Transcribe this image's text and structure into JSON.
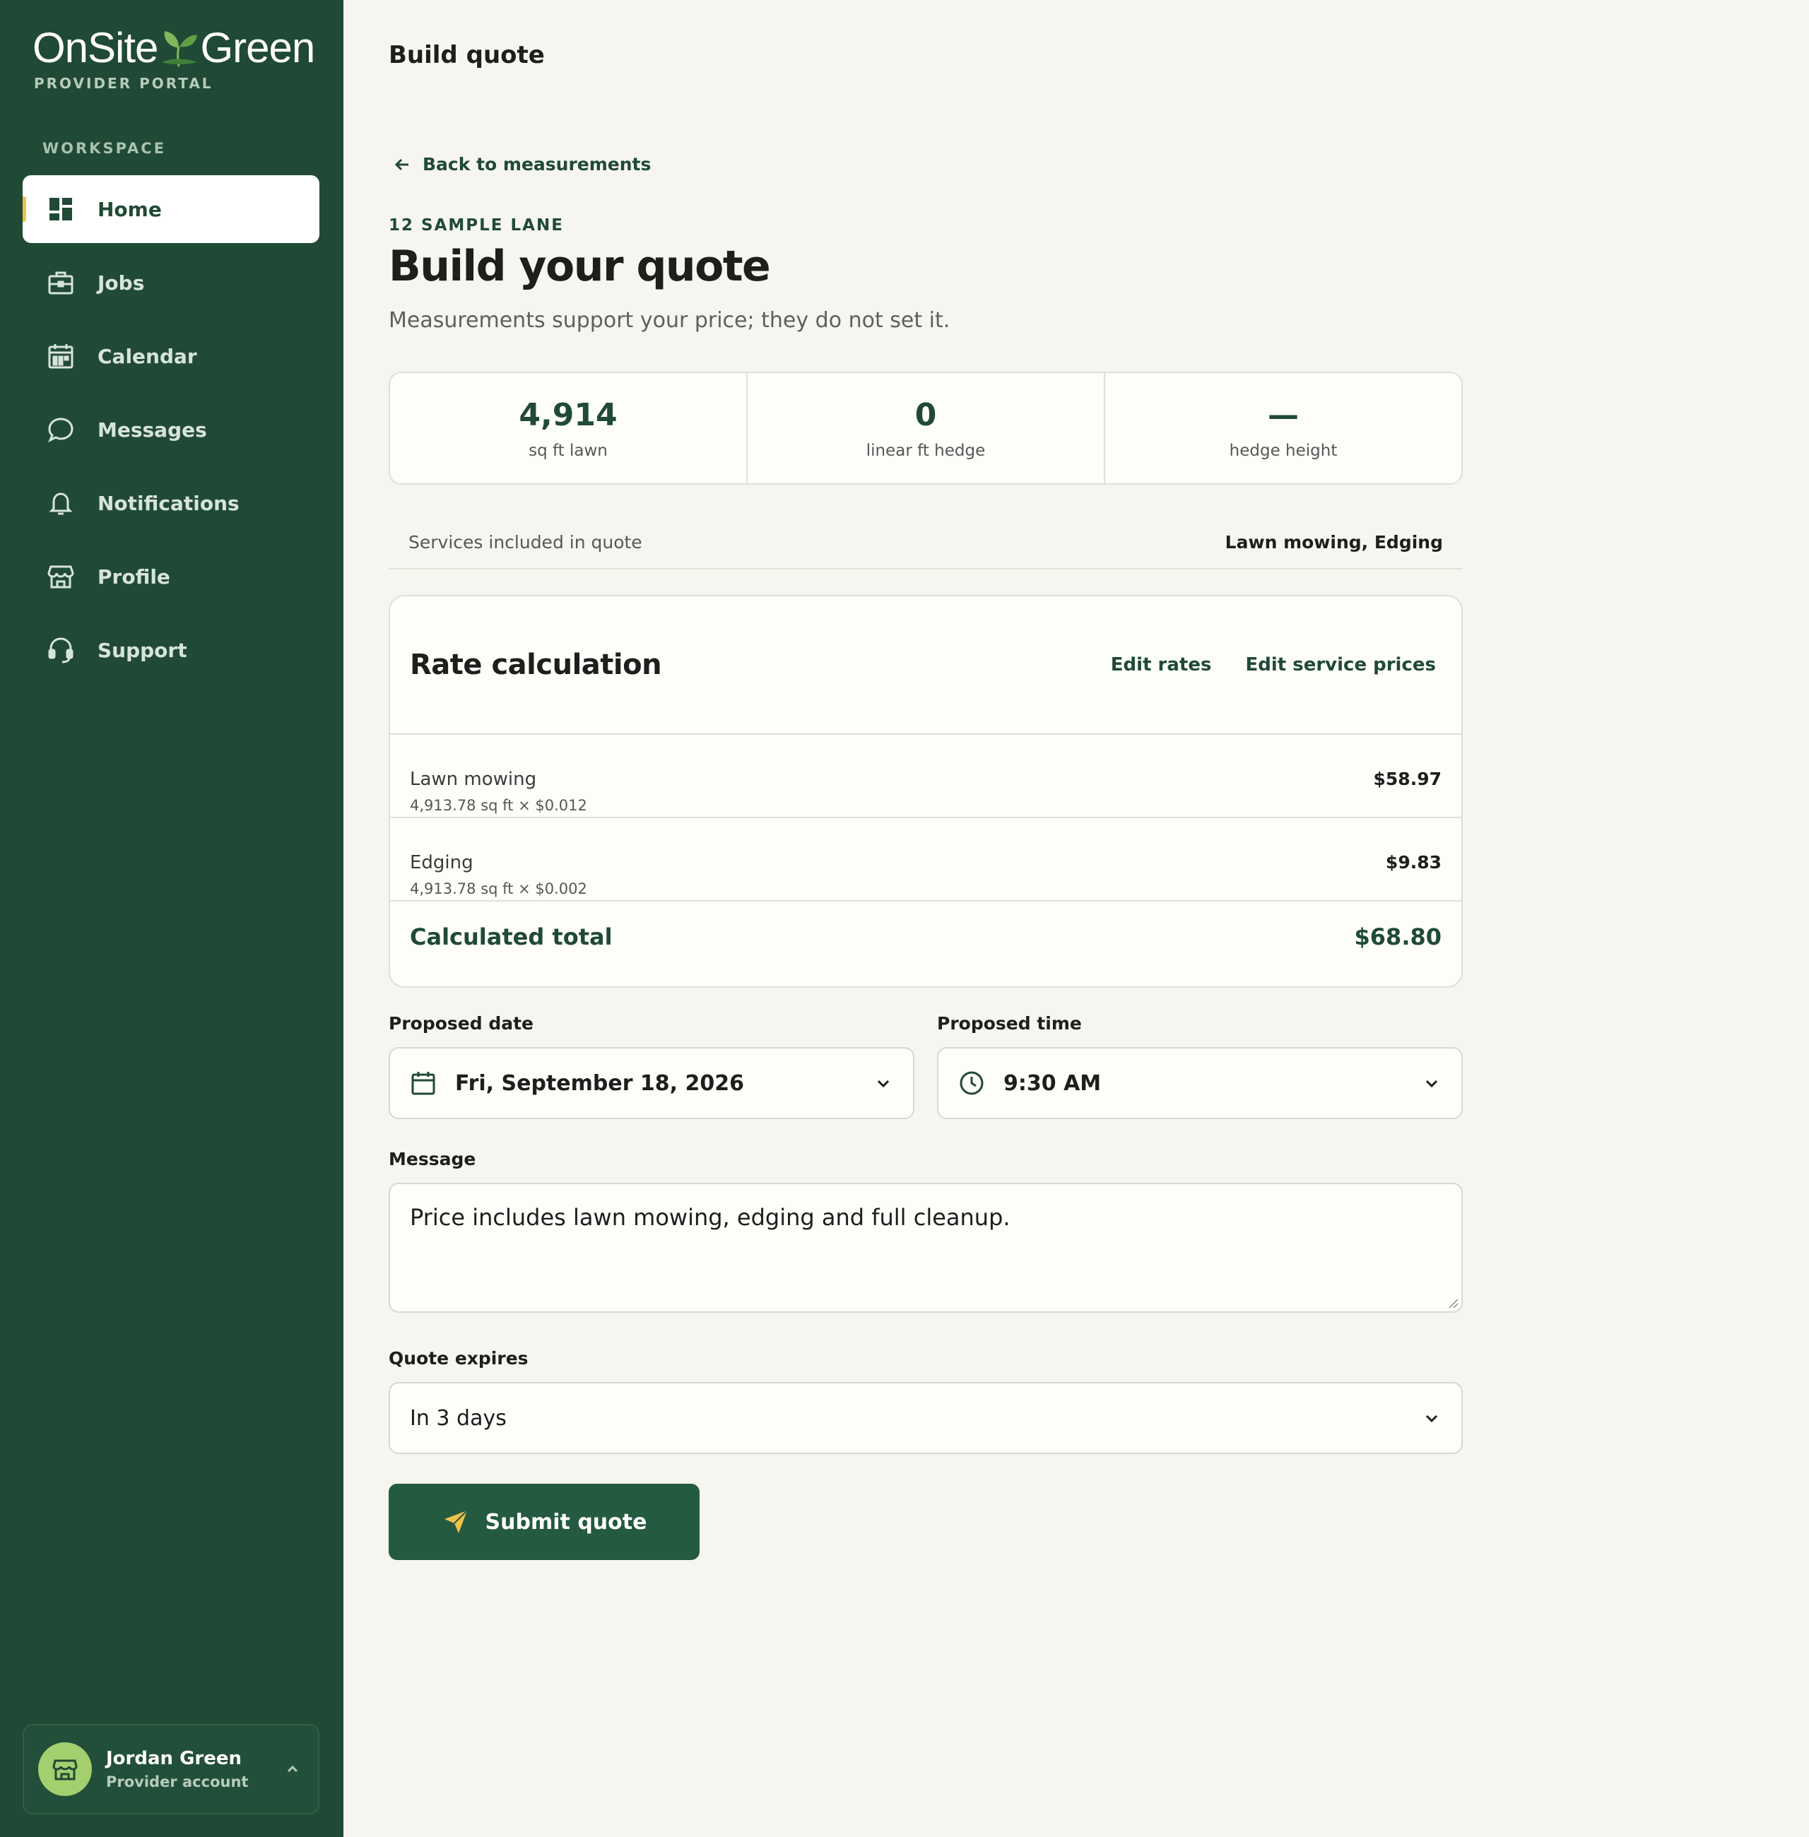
{
  "brand": {
    "name_left": "OnSite",
    "name_right": "Green",
    "subtitle": "PROVIDER PORTAL",
    "primary_color": "#204a35",
    "accent_color": "#f0c24a"
  },
  "sidebar": {
    "section_label": "WORKSPACE",
    "items": [
      {
        "label": "Home",
        "icon": "dashboard-icon",
        "active": true
      },
      {
        "label": "Jobs",
        "icon": "toolbox-icon"
      },
      {
        "label": "Calendar",
        "icon": "calendar-icon"
      },
      {
        "label": "Messages",
        "icon": "chat-icon"
      },
      {
        "label": "Notifications",
        "icon": "bell-icon"
      },
      {
        "label": "Profile",
        "icon": "storefront-icon"
      },
      {
        "label": "Support",
        "icon": "headset-icon"
      }
    ],
    "account": {
      "name": "Jordan Green",
      "role": "Provider account"
    }
  },
  "header": {
    "title": "Build quote"
  },
  "main": {
    "back_label": "Back to measurements",
    "address": "12 SAMPLE LANE",
    "title": "Build your quote",
    "subtitle": "Measurements support your price; they do not set it.",
    "stats": [
      {
        "value": "4,914",
        "label": "sq ft lawn"
      },
      {
        "value": "0",
        "label": "linear ft hedge"
      },
      {
        "value": "—",
        "label": "hedge height"
      }
    ],
    "services": {
      "label": "Services included in quote",
      "value": "Lawn mowing, Edging"
    },
    "rate": {
      "title": "Rate calculation",
      "edit_rates": "Edit rates",
      "edit_prices": "Edit service prices",
      "rows": [
        {
          "name": "Lawn mowing",
          "formula": "4,913.78 sq ft × $0.012",
          "amount": "$58.97"
        },
        {
          "name": "Edging",
          "formula": "4,913.78 sq ft × $0.002",
          "amount": "$9.83"
        }
      ],
      "total_label": "Calculated total",
      "total_value": "$68.80"
    },
    "date": {
      "label": "Proposed date",
      "value": "Fri, September 18, 2026"
    },
    "time": {
      "label": "Proposed time",
      "value": "9:30 AM"
    },
    "message": {
      "label": "Message",
      "value": "Price includes lawn mowing, edging and full cleanup."
    },
    "expires": {
      "label": "Quote expires",
      "value": "In 3 days"
    },
    "submit_label": "Submit quote"
  }
}
